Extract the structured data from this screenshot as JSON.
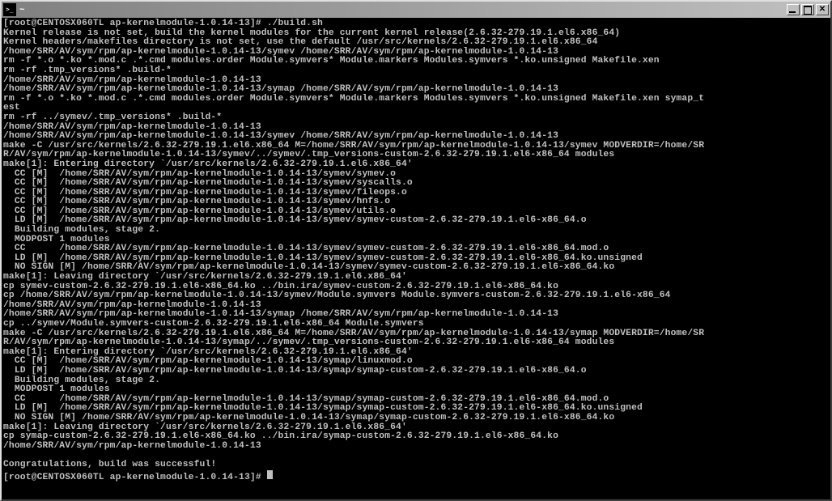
{
  "window": {
    "title": "~"
  },
  "terminal": {
    "lines": [
      "[root@CENTOSX060TL ap-kernelmodule-1.0.14-13]# ./build.sh",
      "Kernel release is not set, build the kernel modules for the current kernel release(2.6.32-279.19.1.el6.x86_64)",
      "Kernel headers/makefiles directory is not set, use the default /usr/src/kernels/2.6.32-279.19.1.el6.x86_64",
      "/home/SRR/AV/sym/rpm/ap-kernelmodule-1.0.14-13/symev /home/SRR/AV/sym/rpm/ap-kernelmodule-1.0.14-13",
      "rm -f *.o *.ko *.mod.c .*.cmd modules.order Module.symvers* Module.markers Modules.symvers *.ko.unsigned Makefile.xen",
      "rm -rf .tmp_versions* .build-*",
      "/home/SRR/AV/sym/rpm/ap-kernelmodule-1.0.14-13",
      "/home/SRR/AV/sym/rpm/ap-kernelmodule-1.0.14-13/symap /home/SRR/AV/sym/rpm/ap-kernelmodule-1.0.14-13",
      "rm -f *.o *.ko *.mod.c .*.cmd modules.order Module.symvers* Module.markers Modules.symvers *.ko.unsigned Makefile.xen symap_t",
      "est",
      "rm -rf ../symev/.tmp_versions* .build-*",
      "/home/SRR/AV/sym/rpm/ap-kernelmodule-1.0.14-13",
      "/home/SRR/AV/sym/rpm/ap-kernelmodule-1.0.14-13/symev /home/SRR/AV/sym/rpm/ap-kernelmodule-1.0.14-13",
      "make -C /usr/src/kernels/2.6.32-279.19.1.el6.x86_64 M=/home/SRR/AV/sym/rpm/ap-kernelmodule-1.0.14-13/symev MODVERDIR=/home/SR",
      "R/AV/sym/rpm/ap-kernelmodule-1.0.14-13/symev/../symev/.tmp_versions-custom-2.6.32-279.19.1.el6-x86_64 modules",
      "make[1]: Entering directory `/usr/src/kernels/2.6.32-279.19.1.el6.x86_64'",
      "  CC [M]  /home/SRR/AV/sym/rpm/ap-kernelmodule-1.0.14-13/symev/symev.o",
      "  CC [M]  /home/SRR/AV/sym/rpm/ap-kernelmodule-1.0.14-13/symev/syscalls.o",
      "  CC [M]  /home/SRR/AV/sym/rpm/ap-kernelmodule-1.0.14-13/symev/fileops.o",
      "  CC [M]  /home/SRR/AV/sym/rpm/ap-kernelmodule-1.0.14-13/symev/hnfs.o",
      "  CC [M]  /home/SRR/AV/sym/rpm/ap-kernelmodule-1.0.14-13/symev/utils.o",
      "  LD [M]  /home/SRR/AV/sym/rpm/ap-kernelmodule-1.0.14-13/symev/symev-custom-2.6.32-279.19.1.el6-x86_64.o",
      "  Building modules, stage 2.",
      "  MODPOST 1 modules",
      "  CC      /home/SRR/AV/sym/rpm/ap-kernelmodule-1.0.14-13/symev/symev-custom-2.6.32-279.19.1.el6-x86_64.mod.o",
      "  LD [M]  /home/SRR/AV/sym/rpm/ap-kernelmodule-1.0.14-13/symev/symev-custom-2.6.32-279.19.1.el6-x86_64.ko.unsigned",
      "  NO SIGN [M] /home/SRR/AV/sym/rpm/ap-kernelmodule-1.0.14-13/symev/symev-custom-2.6.32-279.19.1.el6-x86_64.ko",
      "make[1]: Leaving directory `/usr/src/kernels/2.6.32-279.19.1.el6.x86_64'",
      "cp symev-custom-2.6.32-279.19.1.el6-x86_64.ko ../bin.ira/symev-custom-2.6.32-279.19.1.el6-x86_64.ko",
      "cp /home/SRR/AV/sym/rpm/ap-kernelmodule-1.0.14-13/symev/Module.symvers Module.symvers-custom-2.6.32-279.19.1.el6-x86_64",
      "/home/SRR/AV/sym/rpm/ap-kernelmodule-1.0.14-13",
      "/home/SRR/AV/sym/rpm/ap-kernelmodule-1.0.14-13/symap /home/SRR/AV/sym/rpm/ap-kernelmodule-1.0.14-13",
      "cp ../symev/Module.symvers-custom-2.6.32-279.19.1.el6-x86_64 Module.symvers",
      "make -C /usr/src/kernels/2.6.32-279.19.1.el6.x86_64 M=/home/SRR/AV/sym/rpm/ap-kernelmodule-1.0.14-13/symap MODVERDIR=/home/SR",
      "R/AV/sym/rpm/ap-kernelmodule-1.0.14-13/symap/../symev/.tmp_versions-custom-2.6.32-279.19.1.el6-x86_64 modules",
      "make[1]: Entering directory `/usr/src/kernels/2.6.32-279.19.1.el6.x86_64'",
      "  CC [M]  /home/SRR/AV/sym/rpm/ap-kernelmodule-1.0.14-13/symap/linuxmod.o",
      "  LD [M]  /home/SRR/AV/sym/rpm/ap-kernelmodule-1.0.14-13/symap/symap-custom-2.6.32-279.19.1.el6-x86_64.o",
      "  Building modules, stage 2.",
      "  MODPOST 1 modules",
      "  CC      /home/SRR/AV/sym/rpm/ap-kernelmodule-1.0.14-13/symap/symap-custom-2.6.32-279.19.1.el6-x86_64.mod.o",
      "  LD [M]  /home/SRR/AV/sym/rpm/ap-kernelmodule-1.0.14-13/symap/symap-custom-2.6.32-279.19.1.el6-x86_64.ko.unsigned",
      "  NO SIGN [M] /home/SRR/AV/sym/rpm/ap-kernelmodule-1.0.14-13/symap/symap-custom-2.6.32-279.19.1.el6-x86_64.ko",
      "make[1]: Leaving directory `/usr/src/kernels/2.6.32-279.19.1.el6.x86_64'",
      "cp symap-custom-2.6.32-279.19.1.el6-x86_64.ko ../bin.ira/symap-custom-2.6.32-279.19.1.el6-x86_64.ko",
      "/home/SRR/AV/sym/rpm/ap-kernelmodule-1.0.14-13",
      "",
      "Congratulations, build was successful!",
      "[root@CENTOSX060TL ap-kernelmodule-1.0.14-13]# "
    ]
  }
}
